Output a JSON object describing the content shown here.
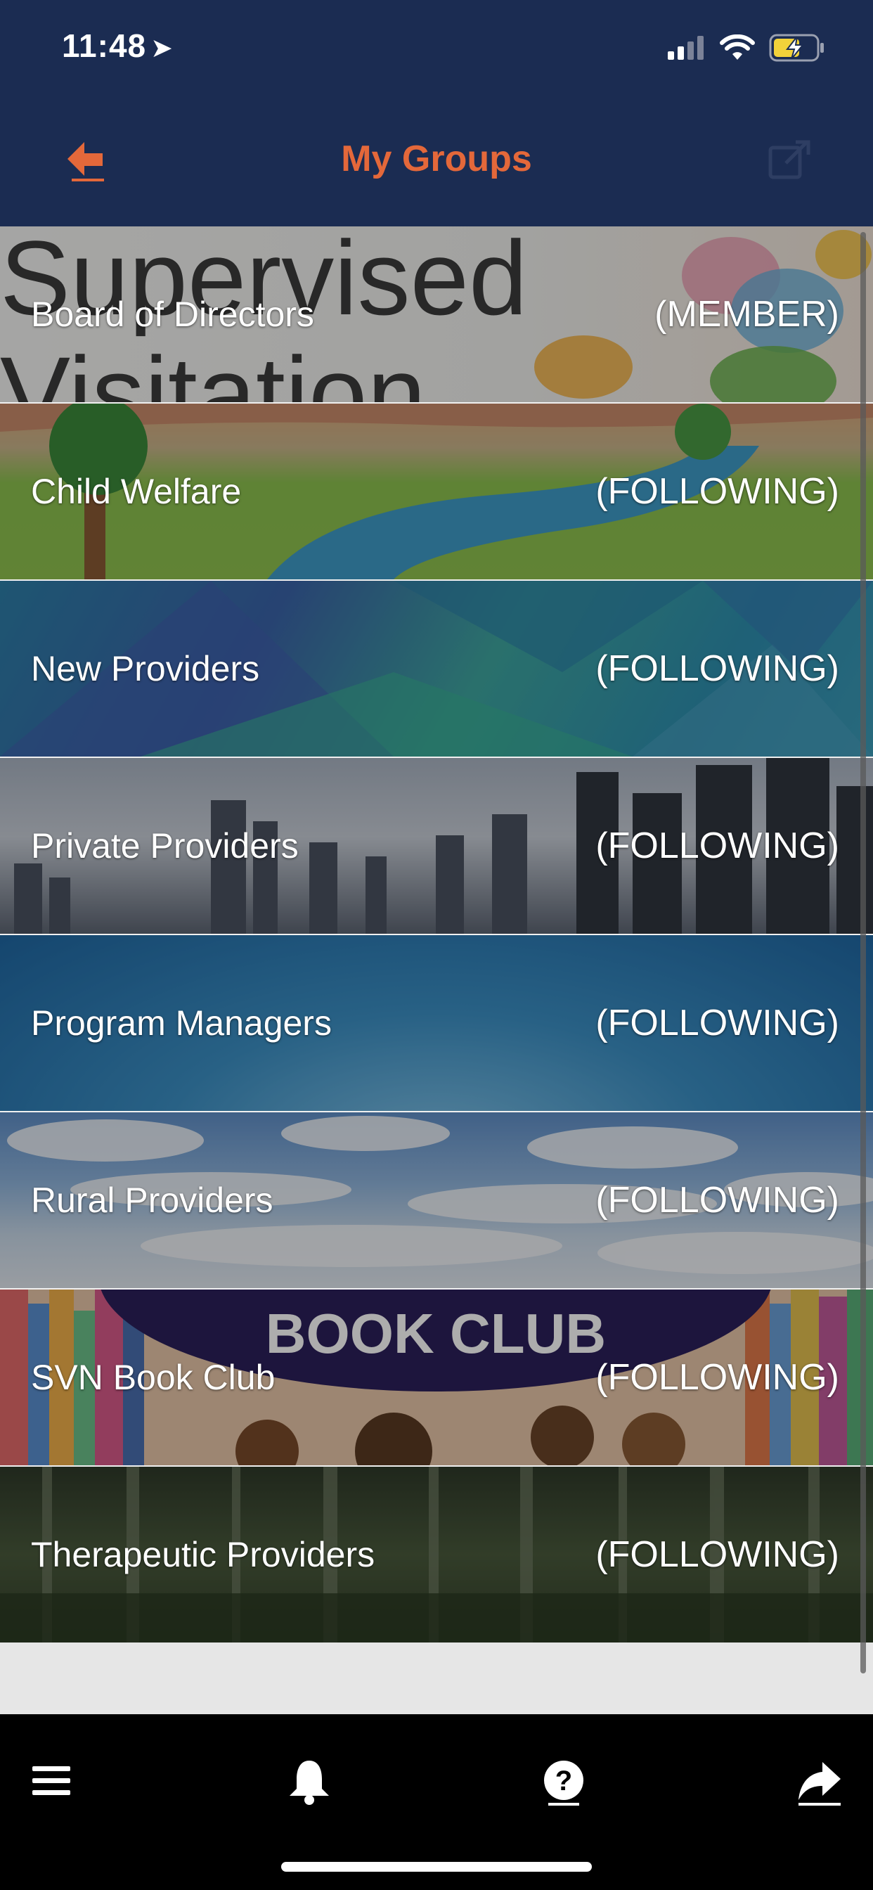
{
  "status_bar": {
    "time": "11:48",
    "location_glyph": "➤"
  },
  "nav": {
    "title": "My Groups"
  },
  "groups": [
    {
      "name": "Board of Directors",
      "status": "(MEMBER)"
    },
    {
      "name": "Child Welfare",
      "status": "(FOLLOWING)"
    },
    {
      "name": "New Providers",
      "status": "(FOLLOWING)"
    },
    {
      "name": "Private Providers",
      "status": "(FOLLOWING)"
    },
    {
      "name": "Program Managers",
      "status": "(FOLLOWING)"
    },
    {
      "name": "Rural Providers",
      "status": "(FOLLOWING)"
    },
    {
      "name": "SVN Book Club",
      "status": "(FOLLOWING)"
    },
    {
      "name": "Therapeutic Providers",
      "status": "(FOLLOWING)"
    }
  ],
  "banner_text": {
    "supervised": "Supervised",
    "visitation": "Visitation",
    "book_club": "BOOK CLUB"
  },
  "icons": [
    "arrow-left-icon",
    "share-icon",
    "menu-icon",
    "bell-icon",
    "help-icon",
    "forward-icon"
  ],
  "colors": {
    "header_bg": "#1b2c52",
    "accent": "#e4683a",
    "tabbar_bg": "#000000",
    "list_bg": "#e6e6e6"
  }
}
